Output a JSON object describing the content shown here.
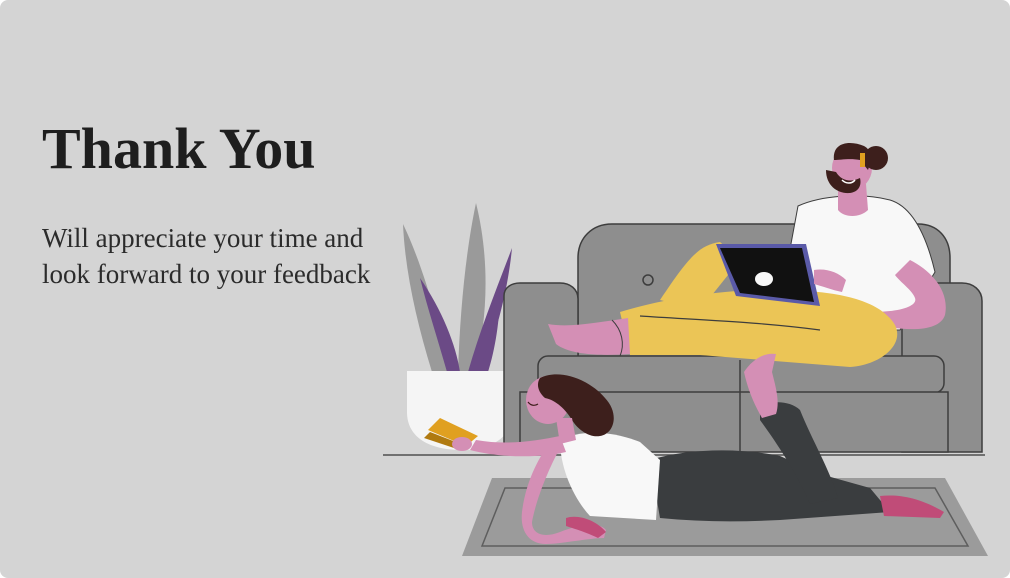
{
  "thank_you": {
    "title": "Thank You",
    "message": "Will appreciate your time and look forward to your feedback"
  },
  "illustration": {
    "description_icon": "relaxing-couple-illustration",
    "colors": {
      "background": "#d4d4d4",
      "sofa": "#8c8c8c",
      "plant_purple": "#6b4a86",
      "plant_gray": "#9a9a9a",
      "skin": "#d48fb5",
      "pants_yellow": "#ebc556",
      "pants_dark": "#3a3d3f",
      "laptop": "#111111",
      "laptop_frame": "#5a5aa8",
      "hair": "#3d1f1c",
      "book": "#e0a020",
      "rug": "#9b9b9b"
    }
  }
}
